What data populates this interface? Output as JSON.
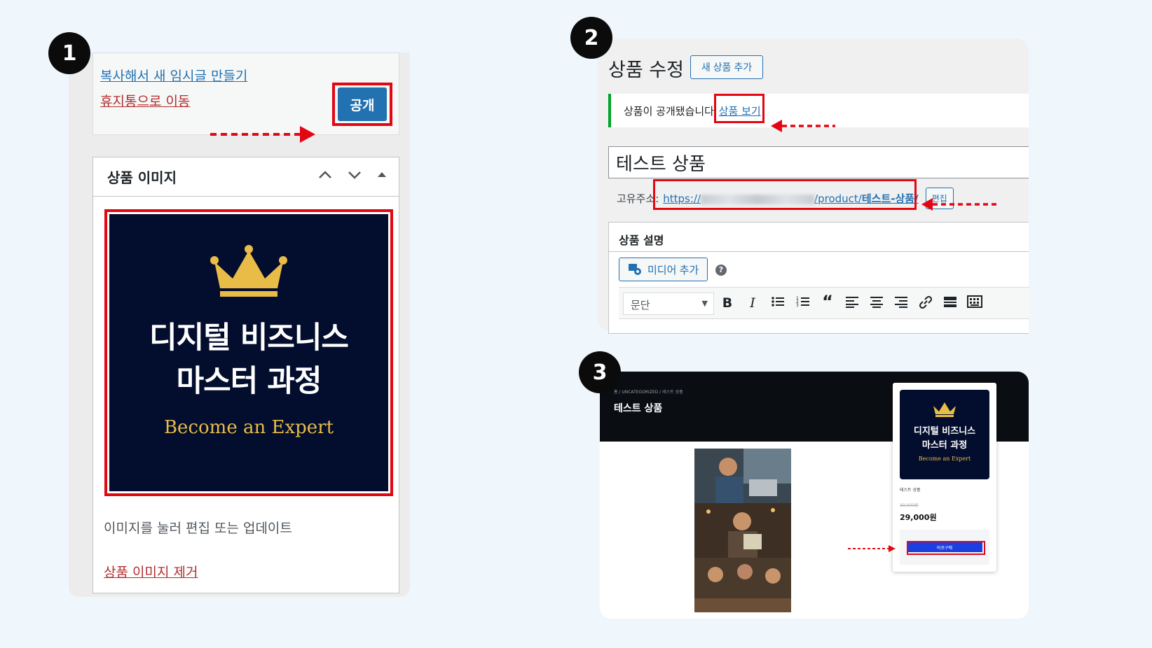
{
  "step1": {
    "badge": "1",
    "copy_link": "복사해서 새 임시글 만들기",
    "trash_link": "휴지통으로 이동",
    "publish_button": "공개",
    "box_title": "상품 이미지",
    "cover_line1": "디지털 비즈니스",
    "cover_line2": "마스터 과정",
    "cover_sub": "Become an Expert",
    "hint": "이미지를 눌러 편집 또는 업데이트",
    "remove_link": "상품 이미지 제거"
  },
  "step2": {
    "badge": "2",
    "title": "상품 수정",
    "add_new_button": "새 상품 추가",
    "notice_text": "상품이 공개됐습니다.",
    "notice_link": "상품 보기",
    "product_name": "테스트 상품",
    "permalink_label": "고유주소:",
    "permalink_prefix": "https://",
    "permalink_path": "/product/",
    "permalink_slug": "테스트-상품/",
    "edit_button": "편집",
    "desc_title": "상품 설명",
    "media_button": "미디어 추가",
    "format_select": "문단"
  },
  "step3": {
    "badge": "3",
    "breadcrumb": "홈 / UNCATEGORIZED / 테스트 상품",
    "page_title": "테스트 상품",
    "card_line1": "디지털 비즈니스",
    "card_line2": "마스터 과정",
    "card_sub": "Become an Expert",
    "card_name": "테스트 상품",
    "old_price": "39,000원",
    "price": "29,000원",
    "buy_button": "바로구매"
  },
  "colors": {
    "highlight": "#e30613",
    "wp_blue": "#2271b1",
    "cover_navy": "#030d2d",
    "gold": "#e8bc46",
    "success_green": "#00a32a"
  }
}
